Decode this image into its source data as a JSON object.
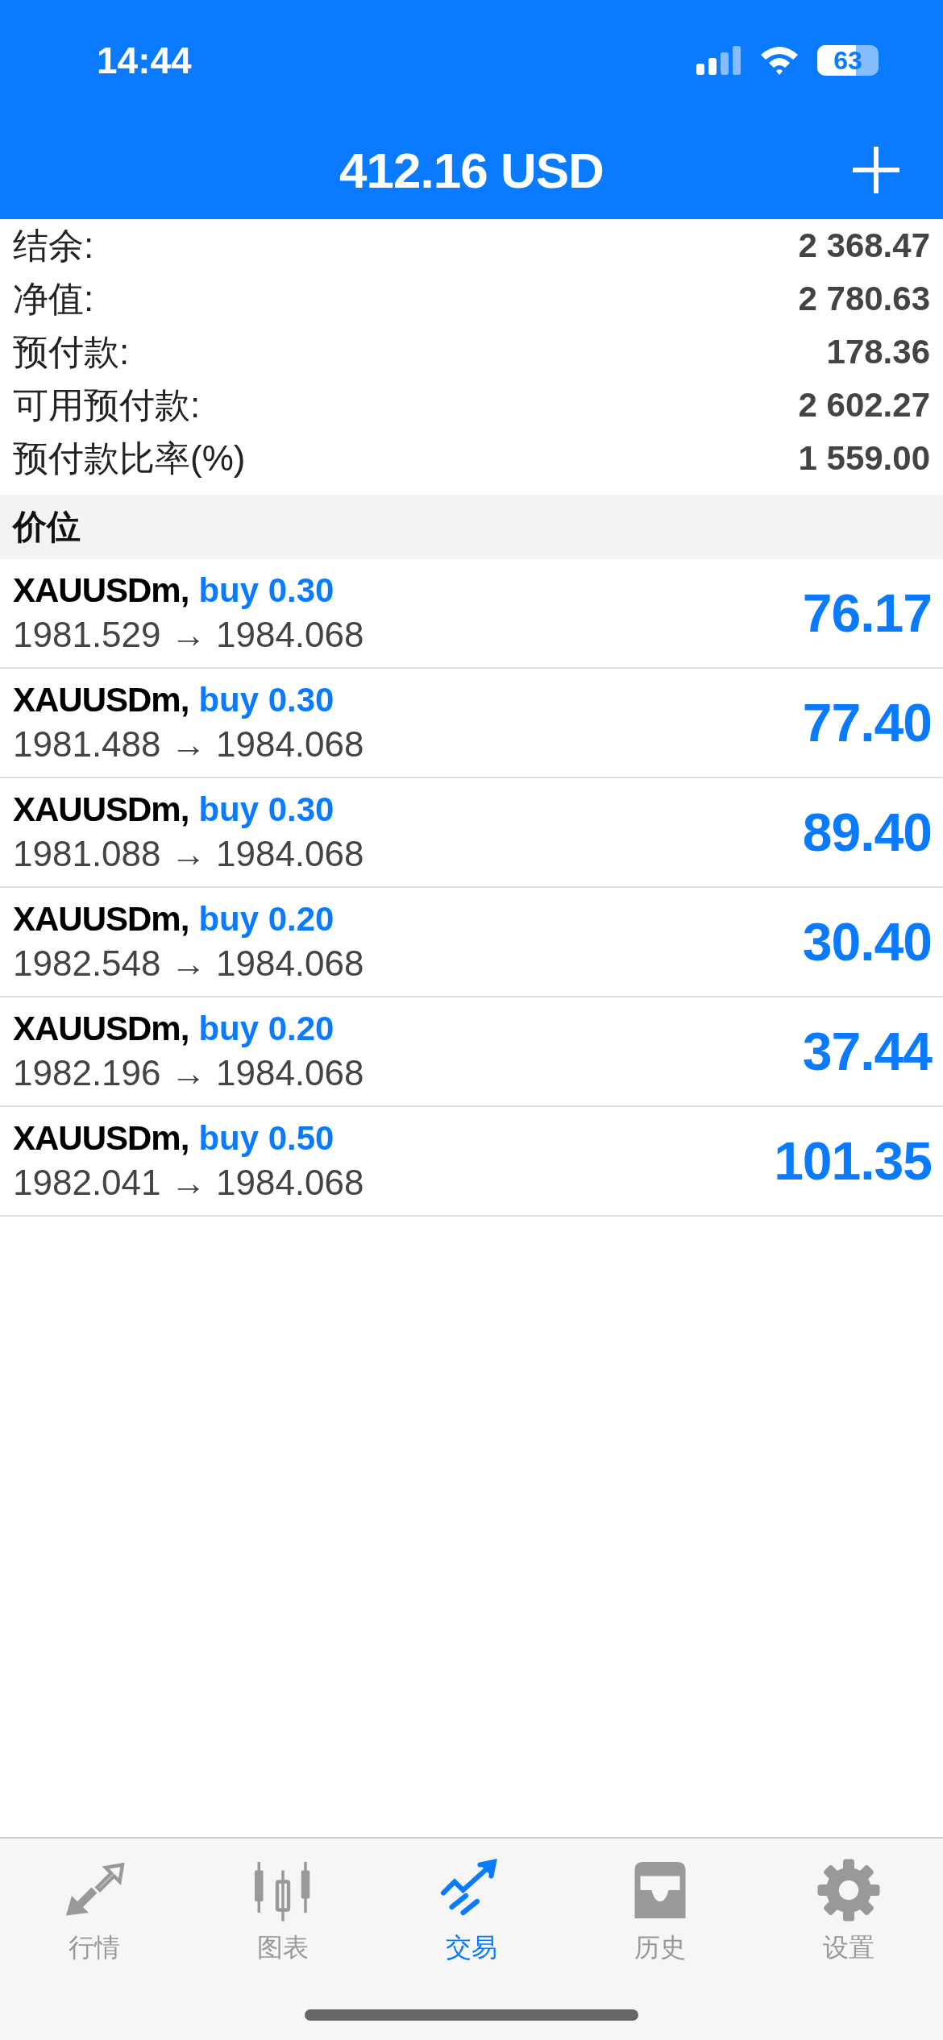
{
  "status_bar": {
    "time": "14:44",
    "battery": "63"
  },
  "header": {
    "title": "412.16 USD"
  },
  "summary": [
    {
      "label": "结余:",
      "value": "2 368.47"
    },
    {
      "label": "净值:",
      "value": "2 780.63"
    },
    {
      "label": "预付款:",
      "value": "178.36"
    },
    {
      "label": "可用预付款:",
      "value": "2 602.27"
    },
    {
      "label": "预付款比率(%)",
      "value": "1 559.00"
    }
  ],
  "section": {
    "title": "价位"
  },
  "positions": [
    {
      "symbol": "XAUUSDm,",
      "order": "buy 0.30",
      "prices": "1981.529 → 1984.068",
      "profit": "76.17"
    },
    {
      "symbol": "XAUUSDm,",
      "order": "buy 0.30",
      "prices": "1981.488 → 1984.068",
      "profit": "77.40"
    },
    {
      "symbol": "XAUUSDm,",
      "order": "buy 0.30",
      "prices": "1981.088 → 1984.068",
      "profit": "89.40"
    },
    {
      "symbol": "XAUUSDm,",
      "order": "buy 0.20",
      "prices": "1982.548 → 1984.068",
      "profit": "30.40"
    },
    {
      "symbol": "XAUUSDm,",
      "order": "buy 0.20",
      "prices": "1982.196 → 1984.068",
      "profit": "37.44"
    },
    {
      "symbol": "XAUUSDm,",
      "order": "buy 0.50",
      "prices": "1982.041 → 1984.068",
      "profit": "101.35"
    }
  ],
  "tab_bar": [
    {
      "kind": "quotes",
      "label": "行情",
      "selected": false
    },
    {
      "kind": "chart",
      "label": "图表",
      "selected": false
    },
    {
      "kind": "trade",
      "label": "交易",
      "selected": true
    },
    {
      "kind": "history",
      "label": "历史",
      "selected": false
    },
    {
      "kind": "settings",
      "label": "设置",
      "selected": false
    }
  ]
}
